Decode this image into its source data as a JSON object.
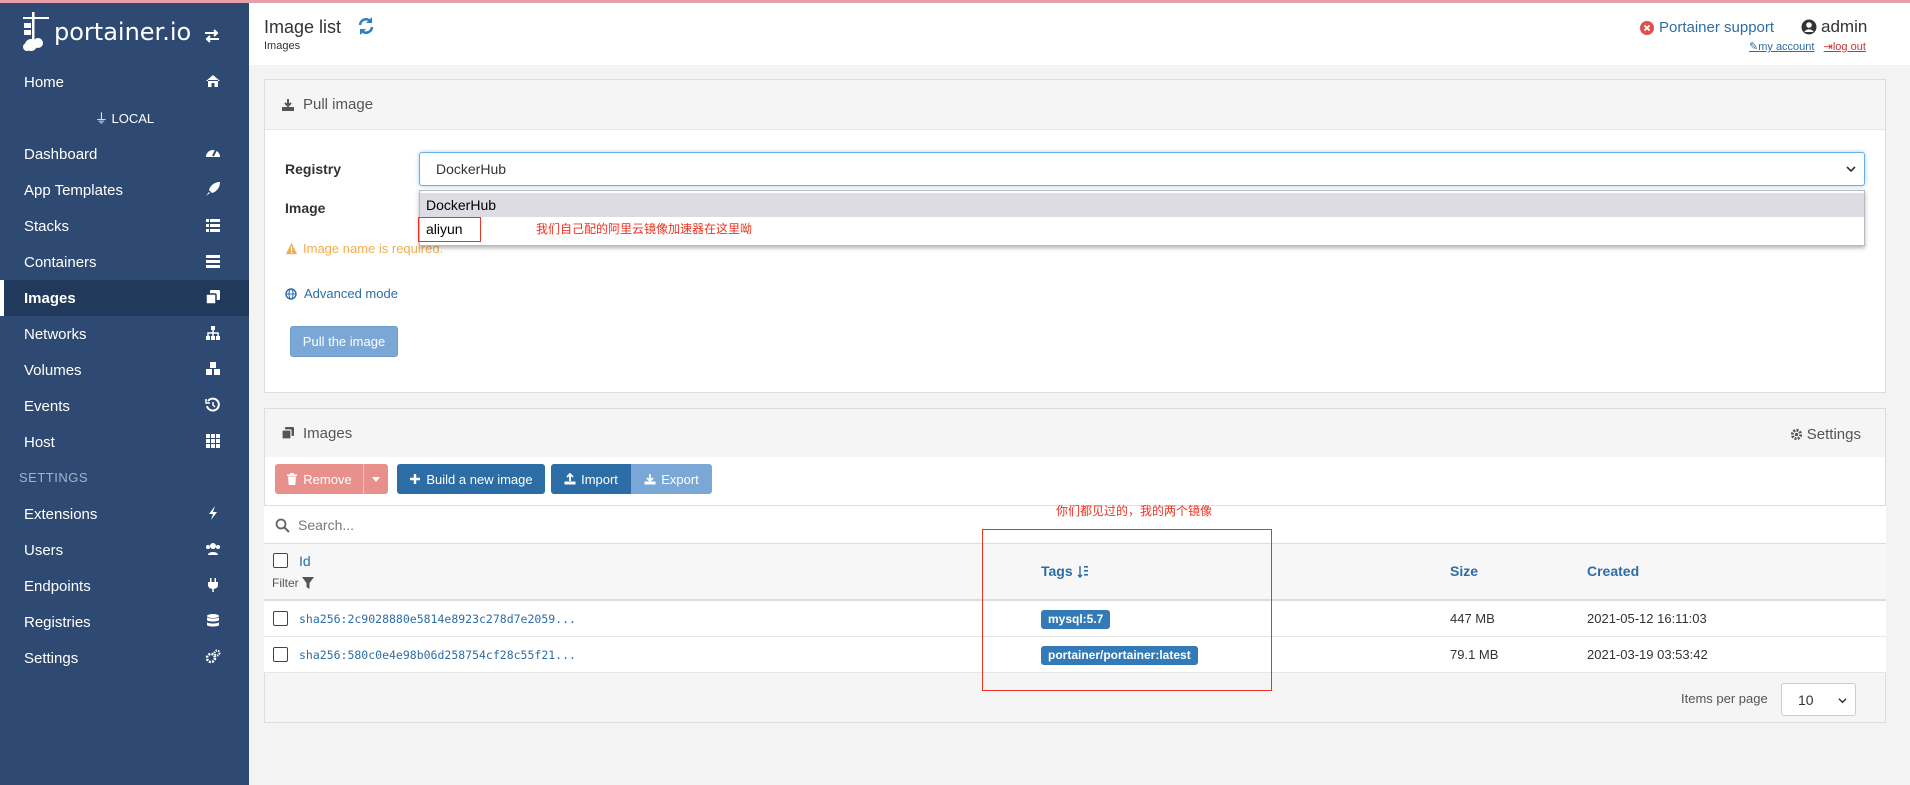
{
  "brand": {
    "name": "portainer.io"
  },
  "sidebar": {
    "endpoint_label": "LOCAL",
    "settings_section": "SETTINGS",
    "items": [
      {
        "label": "Home"
      },
      {
        "label": "Dashboard"
      },
      {
        "label": "App Templates"
      },
      {
        "label": "Stacks"
      },
      {
        "label": "Containers"
      },
      {
        "label": "Images"
      },
      {
        "label": "Networks"
      },
      {
        "label": "Volumes"
      },
      {
        "label": "Events"
      },
      {
        "label": "Host"
      }
    ],
    "settings_items": [
      {
        "label": "Extensions"
      },
      {
        "label": "Users"
      },
      {
        "label": "Endpoints"
      },
      {
        "label": "Registries"
      },
      {
        "label": "Settings"
      }
    ]
  },
  "header": {
    "title": "Image list",
    "breadcrumb": "Images",
    "support": "Portainer support",
    "user": "admin",
    "my_account": "my account",
    "log_out": "log out"
  },
  "pull": {
    "title": "Pull image",
    "registry_label": "Registry",
    "registry_value": "DockerHub",
    "image_label": "Image",
    "options": [
      "DockerHub",
      "aliyun"
    ],
    "warning": "Image name is required.",
    "advanced": "Advanced mode",
    "button": "Pull the image"
  },
  "annotations": {
    "registry_note": "我们自己配的阿里云镜像加速器在这里呦",
    "tags_note": "你们都见过的，我的两个镜像"
  },
  "images": {
    "title": "Images",
    "settings": "Settings",
    "buttons": {
      "remove": "Remove",
      "build": "Build a new image",
      "import": "Import",
      "export": "Export"
    },
    "search_placeholder": "Search...",
    "columns": {
      "id": "Id",
      "filter": "Filter",
      "tags": "Tags",
      "size": "Size",
      "created": "Created"
    },
    "rows": [
      {
        "id": "sha256:2c9028880e5814e8923c278d7e2059...",
        "tag": "mysql:5.7",
        "size": "447 MB",
        "created": "2021-05-12 16:11:03"
      },
      {
        "id": "sha256:580c0e4e98b06d258754cf28c55f21...",
        "tag": "portainer/portainer:latest",
        "size": "79.1 MB",
        "created": "2021-03-19 03:53:42"
      }
    ],
    "items_per_page_label": "Items per page",
    "items_per_page_value": "10"
  }
}
